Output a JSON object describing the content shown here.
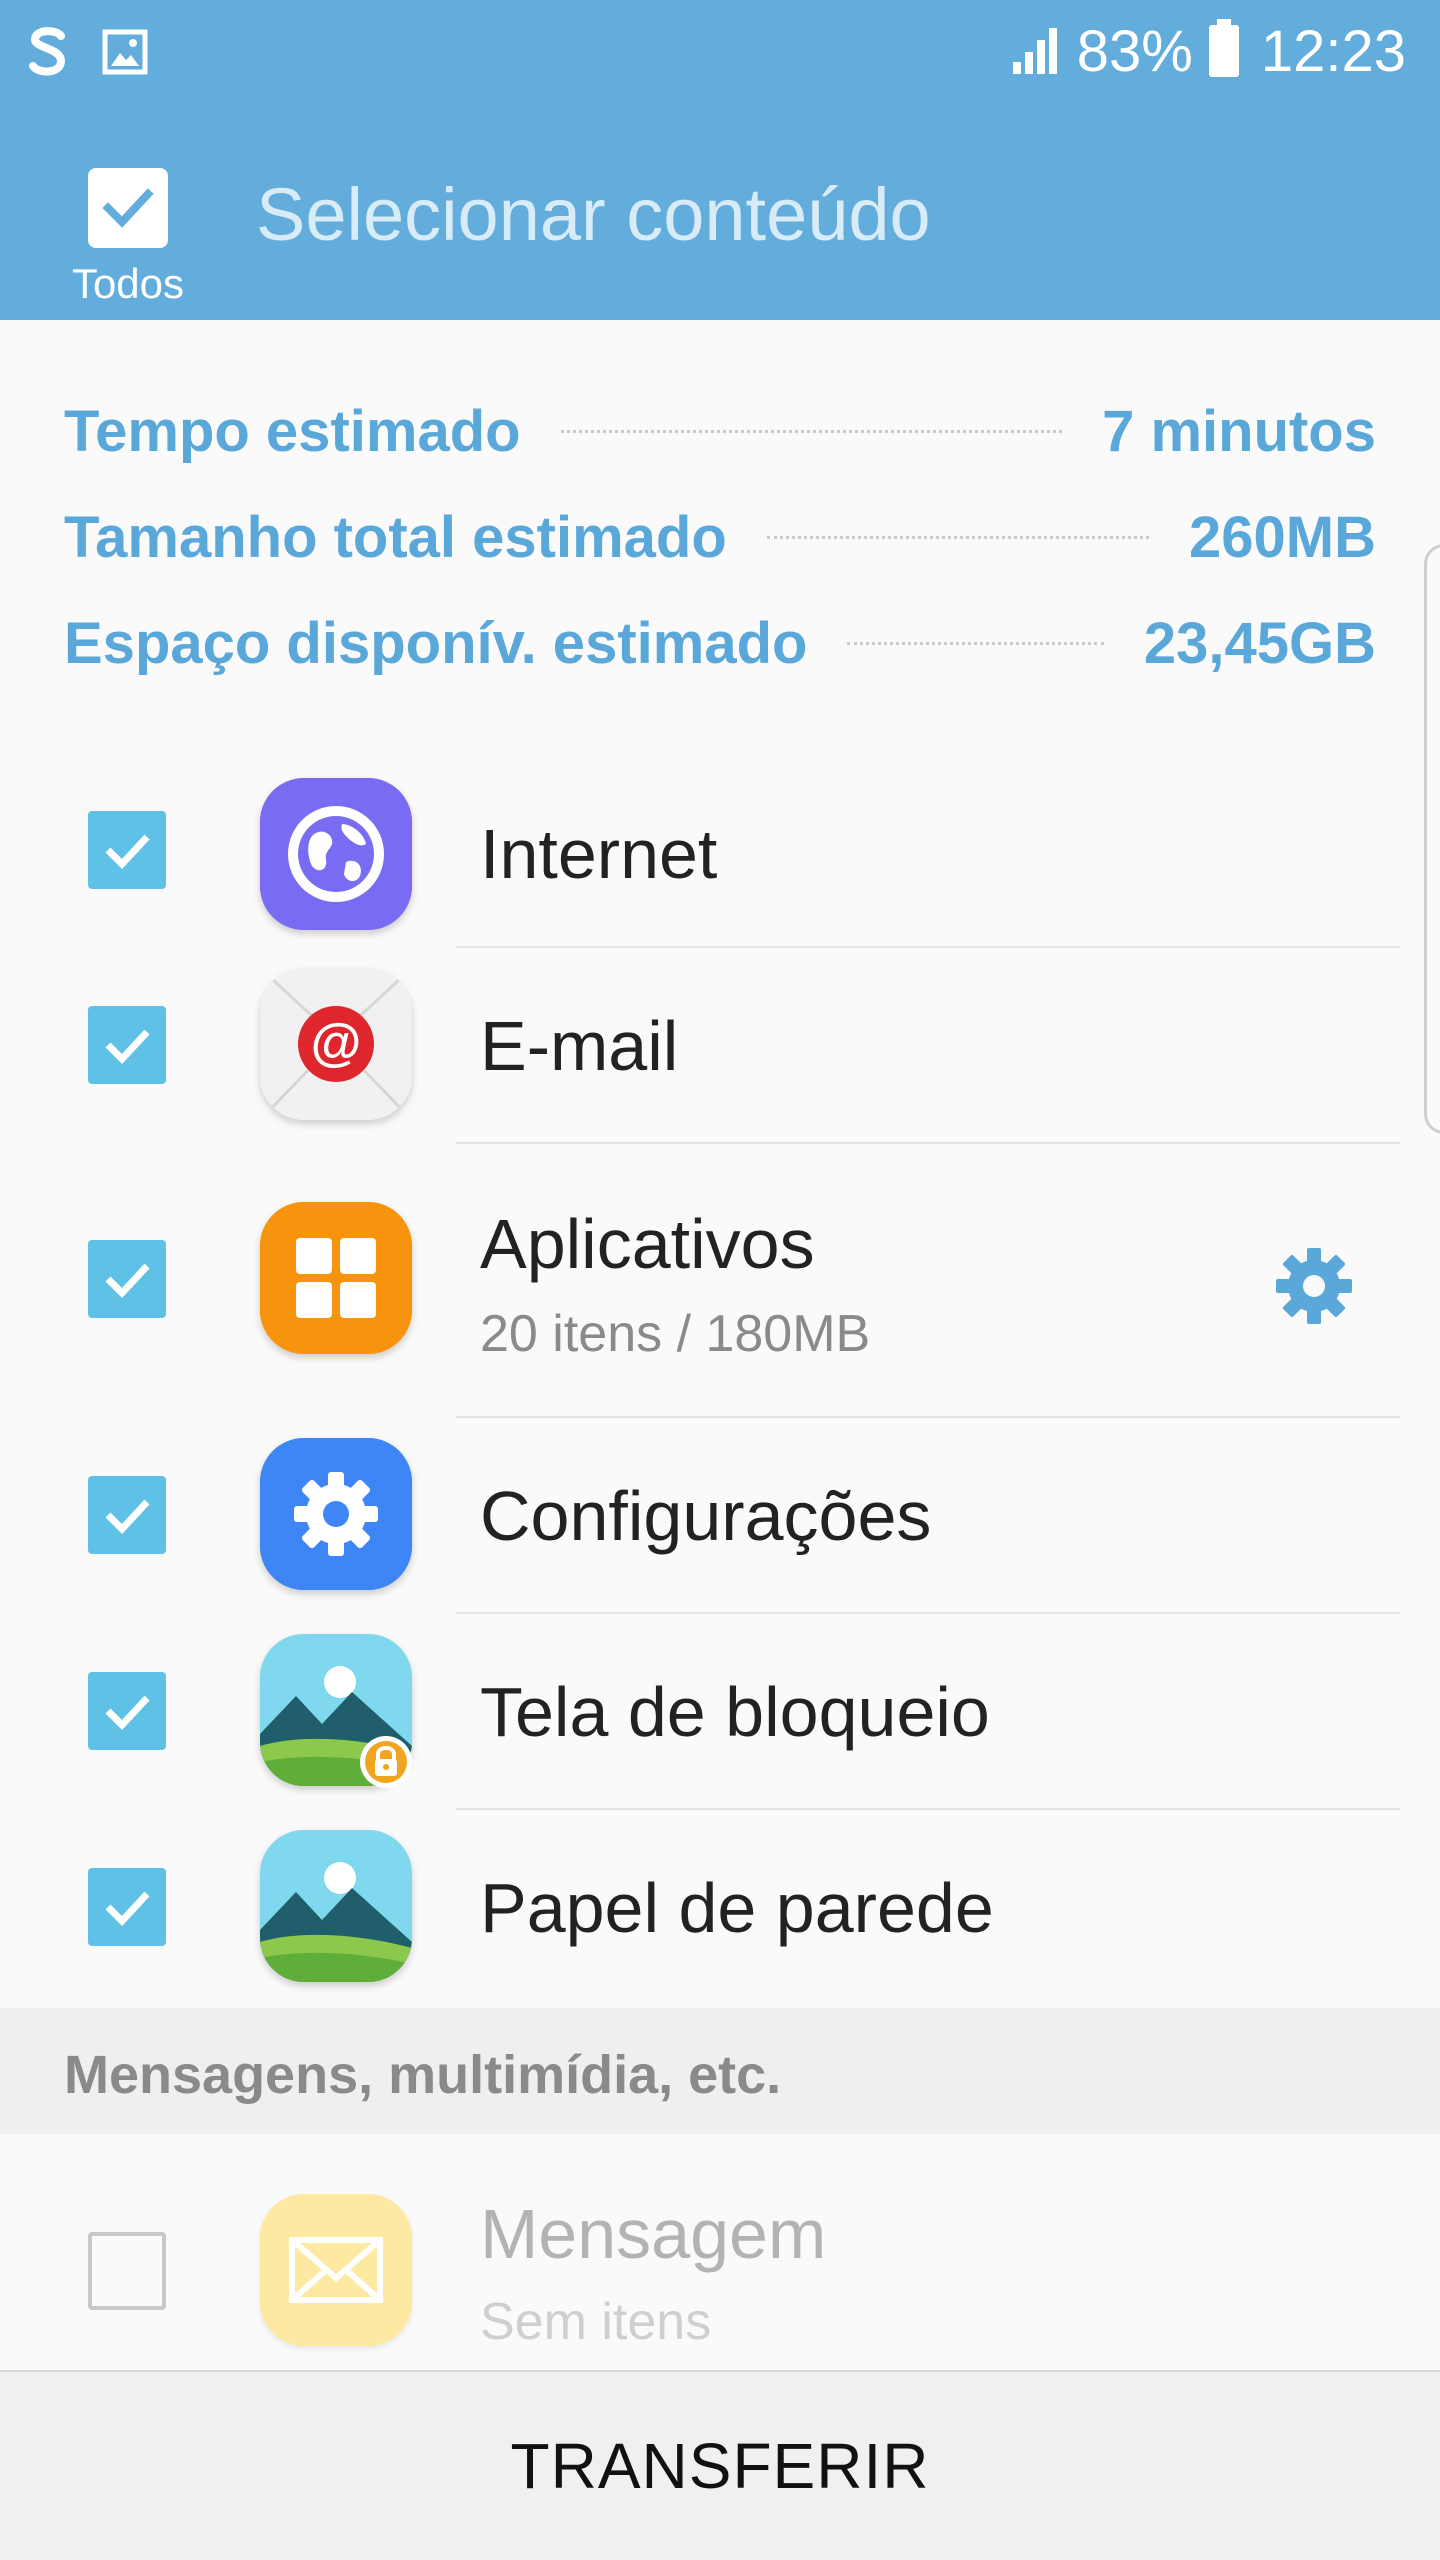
{
  "status_bar": {
    "battery": "83%",
    "time": "12:23"
  },
  "header": {
    "select_all_label": "Todos",
    "title": "Selecionar conteúdo"
  },
  "summary": [
    {
      "label": "Tempo estimado",
      "value": "7 minutos"
    },
    {
      "label": "Tamanho total estimado",
      "value": "260MB"
    },
    {
      "label": "Espaço disponív. estimado",
      "value": "23,45GB"
    }
  ],
  "items": [
    {
      "title": "Internet",
      "checked": true,
      "icon": "internet-globe-icon"
    },
    {
      "title": "E-mail",
      "checked": true,
      "icon": "email-at-icon"
    },
    {
      "title": "Aplicativos",
      "subtitle": "20 itens / 180MB",
      "checked": true,
      "icon": "apps-grid-icon"
    },
    {
      "title": "Configurações",
      "checked": true,
      "icon": "settings-gear-icon"
    },
    {
      "title": "Tela de bloqueio",
      "checked": true,
      "icon": "lockscreen-landscape-icon"
    },
    {
      "title": "Papel de parede",
      "checked": true,
      "icon": "wallpaper-landscape-icon"
    }
  ],
  "section": {
    "label": "Mensagens, multimídia, etc.",
    "items": [
      {
        "title": "Mensagem",
        "subtitle": "Sem itens",
        "checked": false,
        "icon": "message-envelope-icon"
      }
    ]
  },
  "footer": {
    "transfer_label": "TRANSFERIR"
  },
  "colors": {
    "app_bar": "#62addb",
    "accent": "#5aa7d9",
    "checkbox": "#5ec1e5"
  }
}
